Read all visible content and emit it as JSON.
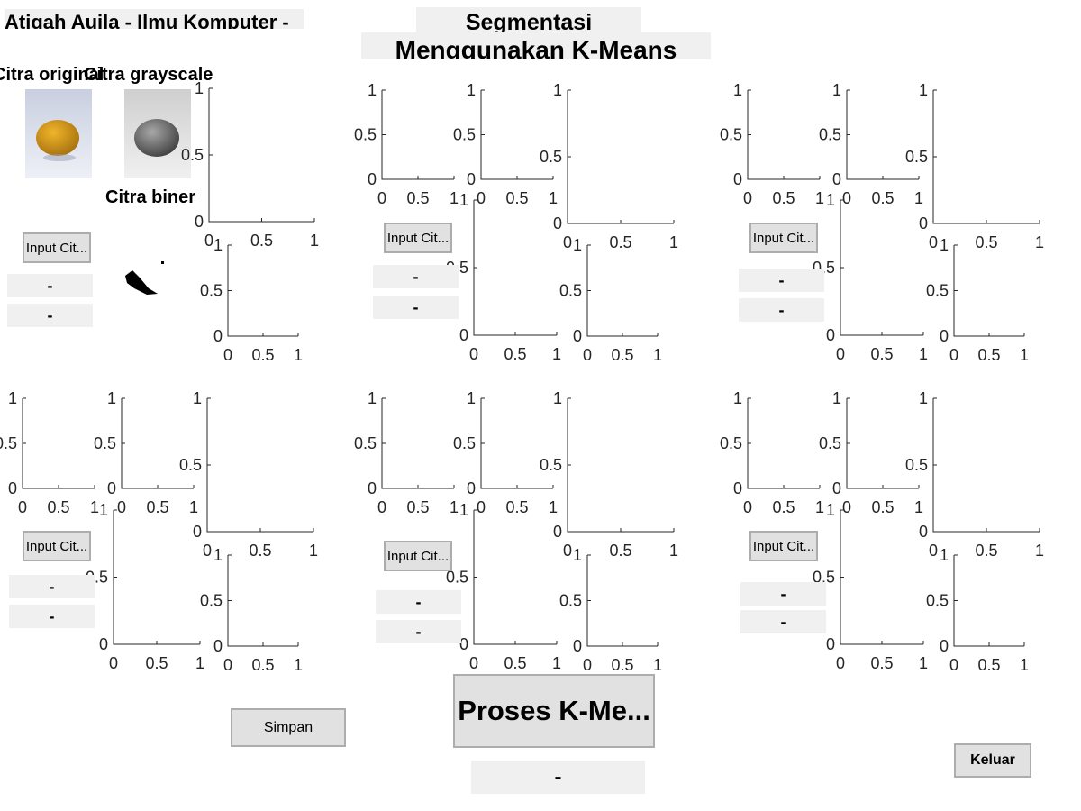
{
  "header": {
    "author_text": "Atiqah Auila - Ilmu Komputer -",
    "title_line1": "Segmentasi",
    "title_line2": "Menggunakan K-Means"
  },
  "images": {
    "original_label": "Citra original",
    "grayscale_label": "Citra grayscale",
    "binary_label": "Citra biner"
  },
  "axes_ticks": {
    "y_full": [
      "0",
      "0.5",
      "1"
    ],
    "x_full": [
      "0",
      "0.5",
      "1"
    ]
  },
  "groups": [
    {
      "input_button": "Input Cit...",
      "field1": "-",
      "field2": "-"
    },
    {
      "input_button": "Input Cit...",
      "field1": "-",
      "field2": "-"
    },
    {
      "input_button": "Input Cit...",
      "field1": "-",
      "field2": "-"
    },
    {
      "input_button": "Input Cit...",
      "field1": "-",
      "field2": "-"
    },
    {
      "input_button": "Input Cit...",
      "field1": "-",
      "field2": "-"
    },
    {
      "input_button": "Input Cit...",
      "field1": "-",
      "field2": "-"
    }
  ],
  "controls": {
    "simpan_label": "Simpan",
    "process_label": "Proses K-Me...",
    "process_result": "-",
    "keluar_label": "Keluar"
  },
  "colors": {
    "panel_bg": "#f0f0f0",
    "button_bg": "#e1e1e1",
    "button_border": "#adadad",
    "axis_color": "#262626",
    "original_fruit": "#d69a1a",
    "grayscale_fruit": "#7a7a7a"
  }
}
